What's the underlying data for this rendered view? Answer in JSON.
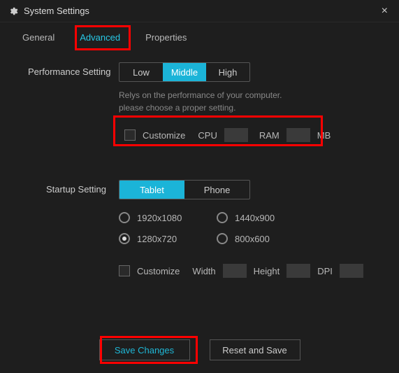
{
  "title": "System Settings",
  "tabs": [
    "General",
    "Advanced",
    "Properties"
  ],
  "performance": {
    "label": "Performance Setting",
    "options": [
      "Low",
      "Middle",
      "High"
    ],
    "selected": "Middle",
    "help1": "Relys on the performance of your computer.",
    "help2": "please choose a proper setting.",
    "customize": "Customize",
    "cpu": "CPU",
    "cpu_val": "",
    "ram": "RAM",
    "ram_val": "",
    "mb": "MB"
  },
  "startup": {
    "label": "Startup Setting",
    "devices": [
      "Tablet",
      "Phone"
    ],
    "selected_device": "Tablet",
    "resolutions": [
      "1920x1080",
      "1440x900",
      "1280x720",
      "800x600"
    ],
    "selected_resolution": "1280x720",
    "customize": "Customize",
    "width": "Width",
    "width_val": "",
    "height": "Height",
    "height_val": "",
    "dpi": "DPI",
    "dpi_val": ""
  },
  "buttons": {
    "save": "Save Changes",
    "reset": "Reset and Save"
  },
  "highlights": [
    "tab-advanced",
    "perf-customize-row",
    "save-changes-button"
  ],
  "accent_color": "#1bb4d8",
  "highlight_color": "#ff0000"
}
